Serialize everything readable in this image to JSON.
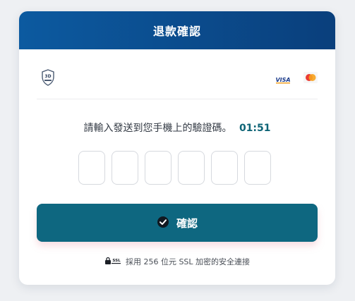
{
  "header": {
    "title": "退款確認"
  },
  "brand": {
    "threeds_badge": "3D",
    "visa_label": "VISA"
  },
  "verification": {
    "prompt": "請輸入發送到您手機上的驗證碼。",
    "timer": "01:51",
    "otp_boxes": [
      "",
      "",
      "",
      "",
      "",
      ""
    ]
  },
  "confirm_button": {
    "label": "確認"
  },
  "footer": {
    "ssl_badge": "SSL",
    "ssl_text": "採用 256 位元 SSL 加密的安全連接"
  },
  "colors": {
    "header_start": "#0c5aa0",
    "header_end": "#0a3f7c",
    "button": "#0e6780",
    "timer": "#0e6476"
  }
}
